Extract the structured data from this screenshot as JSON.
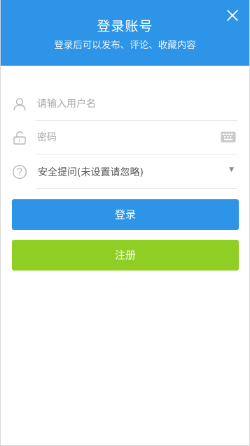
{
  "header": {
    "title": "登录账号",
    "subtitle": "登录后可以发布、评论、收藏内容",
    "background": "#2d94e7"
  },
  "form": {
    "username": {
      "placeholder": "请输入用户名",
      "value": "",
      "icon": "user-icon"
    },
    "password": {
      "placeholder": "密码",
      "value": "",
      "icon": "unlock-icon",
      "trailing_icon": "keyboard-icon"
    },
    "security_question": {
      "selected": "安全提问(未设置请忽略)",
      "icon": "question-circle-icon"
    }
  },
  "buttons": {
    "login": {
      "label": "登录",
      "color": "#2d94e7"
    },
    "register": {
      "label": "注册",
      "color": "#8fce23"
    }
  }
}
